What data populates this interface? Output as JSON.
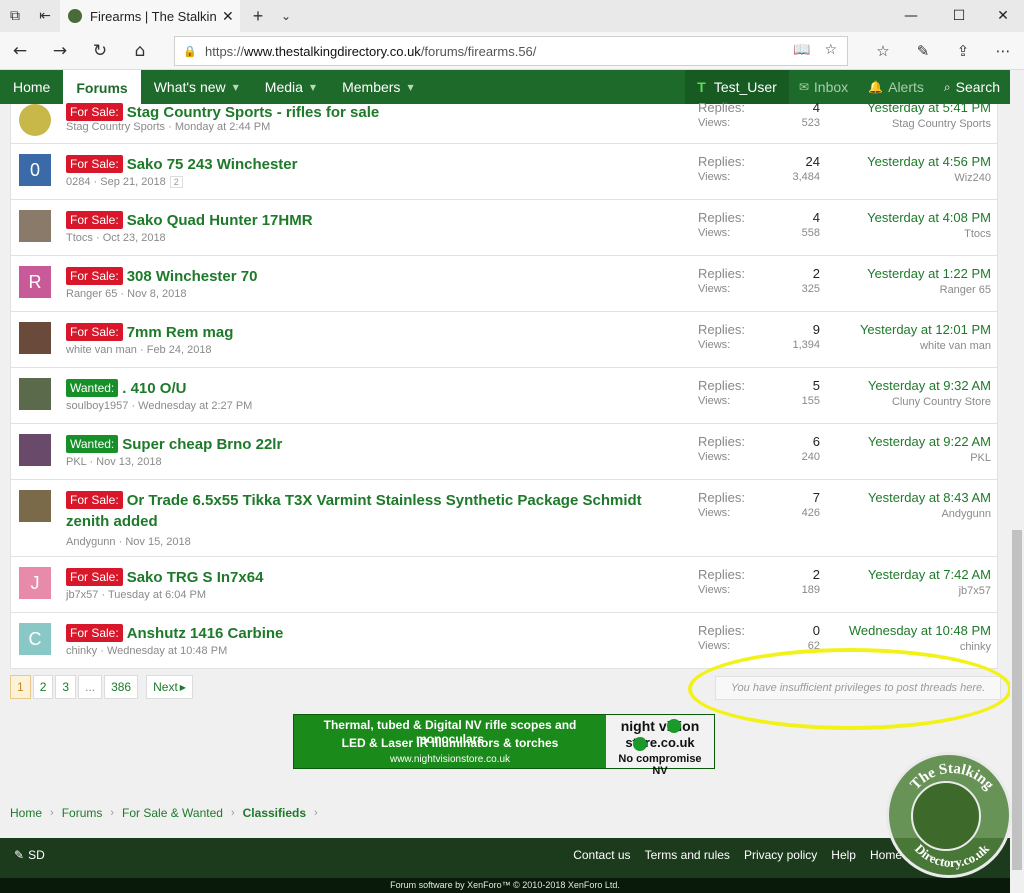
{
  "browser": {
    "tab_title": "Firearms | The Stalking D",
    "url_prefix": "https://",
    "url_domain": "www.thestalkingdirectory.co.uk",
    "url_path": "/forums/firearms.56/"
  },
  "nav": {
    "home": "Home",
    "forums": "Forums",
    "whats_new": "What's new",
    "media": "Media",
    "members": "Members",
    "user": "Test_User",
    "user_initial": "T",
    "inbox": "Inbox",
    "alerts": "Alerts",
    "search": "Search"
  },
  "stat_labels": {
    "replies": "Replies:",
    "views": "Views:"
  },
  "threads": [
    {
      "label": "For Sale:",
      "label_type": "sale",
      "title": "Stag Country Sports - rifles for sale",
      "author": "Stag Country Sports",
      "date": "Monday at 2:44 PM",
      "replies": "4",
      "views": "523",
      "last_date": "Yesterday at 5:41 PM",
      "last_user": "Stag Country Sports",
      "avatar": "",
      "avatar_color": "#c8b84a"
    },
    {
      "label": "For Sale:",
      "label_type": "sale",
      "title": "Sako 75 243 Winchester",
      "author": "0284",
      "date": "Sep 21, 2018",
      "pages": "2",
      "replies": "24",
      "views": "3,484",
      "last_date": "Yesterday at 4:56 PM",
      "last_user": "Wiz240",
      "avatar": "0",
      "avatar_color": "#3a6aa8"
    },
    {
      "label": "For Sale:",
      "label_type": "sale",
      "title": "Sako Quad Hunter 17HMR",
      "author": "Ttocs",
      "date": "Oct 23, 2018",
      "replies": "4",
      "views": "558",
      "last_date": "Yesterday at 4:08 PM",
      "last_user": "Ttocs",
      "avatar": "",
      "avatar_color": "#8a7a6a"
    },
    {
      "label": "For Sale:",
      "label_type": "sale",
      "title": "308 Winchester 70",
      "author": "Ranger 65",
      "date": "Nov 8, 2018",
      "replies": "2",
      "views": "325",
      "last_date": "Yesterday at 1:22 PM",
      "last_user": "Ranger 65",
      "avatar": "R",
      "avatar_color": "#c85a9a"
    },
    {
      "label": "For Sale:",
      "label_type": "sale",
      "title": "7mm Rem mag",
      "author": "white van man",
      "date": "Feb 24, 2018",
      "replies": "9",
      "views": "1,394",
      "last_date": "Yesterday at 12:01 PM",
      "last_user": "white van man",
      "avatar": "",
      "avatar_color": "#6a4a3a"
    },
    {
      "label": "Wanted:",
      "label_type": "wanted",
      "title": ". 410 O/U",
      "author": "soulboy1957",
      "date": "Wednesday at 2:27 PM",
      "replies": "5",
      "views": "155",
      "last_date": "Yesterday at 9:32 AM",
      "last_user": "Cluny Country Store",
      "avatar": "",
      "avatar_color": "#5a6a4a"
    },
    {
      "label": "Wanted:",
      "label_type": "wanted",
      "title": "Super cheap Brno 22lr",
      "author": "PKL",
      "date": "Nov 13, 2018",
      "replies": "6",
      "views": "240",
      "last_date": "Yesterday at 9:22 AM",
      "last_user": "PKL",
      "avatar": "",
      "avatar_color": "#6a4a6a"
    },
    {
      "label": "For Sale:",
      "label_type": "sale",
      "title": "Or Trade 6.5x55 Tikka T3X Varmint Stainless Synthetic Package Schmidt zenith added",
      "author": "Andygunn",
      "date": "Nov 15, 2018",
      "replies": "7",
      "views": "426",
      "last_date": "Yesterday at 8:43 AM",
      "last_user": "Andygunn",
      "avatar": "",
      "avatar_color": "#7a6a4a"
    },
    {
      "label": "For Sale:",
      "label_type": "sale",
      "title": "Sako TRG S In7x64",
      "author": "jb7x57",
      "date": "Tuesday at 6:04 PM",
      "replies": "2",
      "views": "189",
      "last_date": "Yesterday at 7:42 AM",
      "last_user": "jb7x57",
      "avatar": "J",
      "avatar_color": "#e88aaa"
    },
    {
      "label": "For Sale:",
      "label_type": "sale",
      "title": "Anshutz 1416 Carbine",
      "author": "chinky",
      "date": "Wednesday at 10:48 PM",
      "replies": "0",
      "views": "62",
      "last_date": "Wednesday at 10:48 PM",
      "last_user": "chinky",
      "avatar": "C",
      "avatar_color": "#8ac8c8"
    }
  ],
  "pagination": {
    "pages": [
      "1",
      "2",
      "3",
      "...",
      "386"
    ],
    "next": "Next"
  },
  "no_privileges": "You have insufficient privileges to post threads here.",
  "banner": {
    "line1": "Thermal, tubed & Digital NV rifle scopes and monoculars",
    "line2": "LED & Laser IR illuminators & torches",
    "line3": "www.nightvisionstore.co.uk",
    "logo1": "night vision",
    "logo2": "store.co.uk",
    "logo3": "No compromise NV"
  },
  "breadcrumb": [
    "Home",
    "Forums",
    "For Sale & Wanted",
    "Classifieds"
  ],
  "footer": {
    "style": "SD",
    "links": [
      "Contact us",
      "Terms and rules",
      "Privacy policy",
      "Help",
      "Home"
    ],
    "copyright": "Forum software by XenForo™ © 2010-2018 XenForo Ltd."
  },
  "watermark": {
    "line1": "The Stalking",
    "line2": "Directory.co.uk"
  },
  "colors": {
    "brand_green": "#1e6a2a",
    "sale_red": "#d8182a",
    "wanted_green": "#18902a",
    "highlight_yellow": "#f2f21a"
  }
}
